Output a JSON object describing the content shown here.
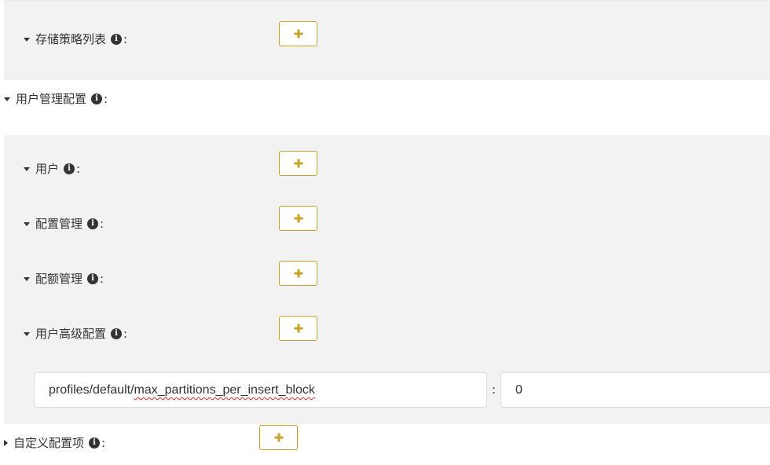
{
  "storage": {
    "policy_list_label": "存储策略列表"
  },
  "user_config": {
    "section_label": "用户管理配置",
    "users_label": "用户",
    "profiles_label": "配置管理",
    "quotas_label": "配额管理",
    "advanced_label": "用户高级配置",
    "advanced_entry": {
      "key_prefix": "profiles/default/",
      "key_misspelled": "max_partitions_per_insert_block",
      "separator": ":",
      "value": "0"
    }
  },
  "custom_config": {
    "section_label": "自定义配置项"
  },
  "icons": {
    "info": "info-circle-icon",
    "add": "plus-icon",
    "expanded": "caret-down-icon",
    "collapsed": "caret-right-icon"
  },
  "colors": {
    "accent": "#c9a227",
    "panel_bg": "#f2f2f2",
    "text": "#333333",
    "spell_error": "#d92a2a"
  },
  "common": {
    "colon": ":",
    "info_glyph": "i"
  }
}
